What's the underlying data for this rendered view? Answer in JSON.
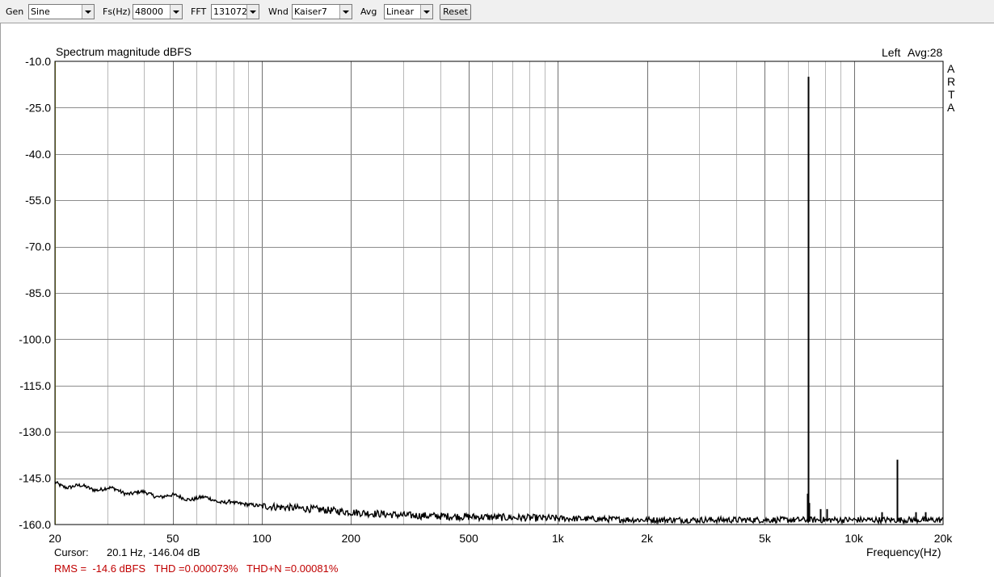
{
  "toolbar": {
    "gen_label": "Gen",
    "gen_value": "Sine",
    "fs_label": "Fs(Hz)",
    "fs_value": "48000",
    "fft_label": "FFT",
    "fft_value": "131072",
    "wnd_label": "Wnd",
    "wnd_value": "Kaiser7",
    "avg_label": "Avg",
    "avg_value": "Linear",
    "reset_label": "Reset"
  },
  "chart_data": {
    "type": "line",
    "title": "Spectrum magnitude dBFS",
    "channel": "Left",
    "avg_text": "Avg:28",
    "watermark": [
      "A",
      "R",
      "T",
      "A"
    ],
    "xlabel": "Frequency(Hz)",
    "x_scale": "log",
    "xlim": [
      20,
      20000
    ],
    "ylim": [
      -160,
      -10
    ],
    "x_ticks": [
      20,
      50,
      100,
      200,
      500,
      1000,
      2000,
      5000,
      10000,
      20000
    ],
    "x_tick_labels": [
      "20",
      "50",
      "100",
      "200",
      "500",
      "1k",
      "2k",
      "5k",
      "10k",
      "20k"
    ],
    "y_ticks": [
      -10,
      -25,
      -40,
      -55,
      -70,
      -85,
      -100,
      -115,
      -130,
      -145,
      -160
    ],
    "y_tick_labels": [
      "-10.0",
      "-25.0",
      "-40.0",
      "-55.0",
      "-70.0",
      "-85.0",
      "-100.0",
      "-115.0",
      "-130.0",
      "-145.0",
      "-160.0"
    ],
    "grid": true,
    "series": [
      {
        "color": "#000000",
        "noise_floor": [
          {
            "x": 20,
            "y": -146.5
          },
          {
            "x": 22,
            "y": -147.5
          },
          {
            "x": 25,
            "y": -148
          },
          {
            "x": 30,
            "y": -148.5
          },
          {
            "x": 35,
            "y": -149.5
          },
          {
            "x": 40,
            "y": -150
          },
          {
            "x": 50,
            "y": -151
          },
          {
            "x": 60,
            "y": -151.5
          },
          {
            "x": 70,
            "y": -152
          },
          {
            "x": 80,
            "y": -153
          },
          {
            "x": 100,
            "y": -154
          },
          {
            "x": 150,
            "y": -155
          },
          {
            "x": 200,
            "y": -156
          },
          {
            "x": 300,
            "y": -157
          },
          {
            "x": 500,
            "y": -157.5
          },
          {
            "x": 1000,
            "y": -158
          },
          {
            "x": 2000,
            "y": -158.5
          },
          {
            "x": 5000,
            "y": -158.5
          },
          {
            "x": 10000,
            "y": -158.5
          },
          {
            "x": 20000,
            "y": -158.5
          }
        ],
        "peaks": [
          {
            "x": 7000,
            "y": -15
          },
          {
            "x": 6960,
            "y": -150
          },
          {
            "x": 7040,
            "y": -153
          },
          {
            "x": 14000,
            "y": -139
          },
          {
            "x": 7700,
            "y": -155
          },
          {
            "x": 8100,
            "y": -155
          },
          {
            "x": 12400,
            "y": -156
          },
          {
            "x": 16200,
            "y": -156
          },
          {
            "x": 17400,
            "y": -156
          }
        ]
      }
    ]
  },
  "footer": {
    "cursor_label": "Cursor:",
    "cursor_value": "20.1 Hz, -146.04 dB",
    "stats": "RMS =  -14.6 dBFS   THD =0.000073%   THD+N =0.00081%"
  }
}
